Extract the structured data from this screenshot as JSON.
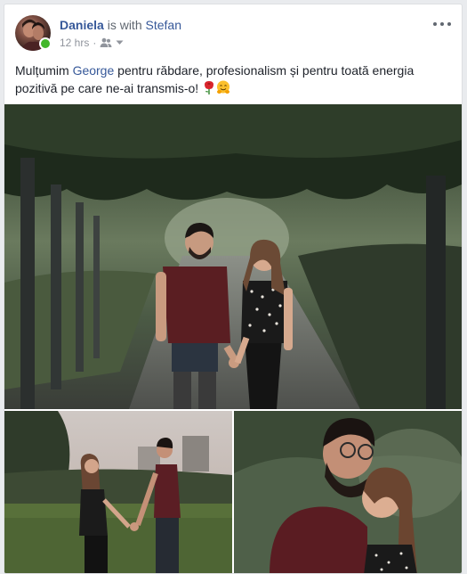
{
  "post": {
    "author": "Daniela",
    "with_text": "is with",
    "with_name": "Stefan",
    "time": "12 hrs",
    "separator": "·",
    "caption_part1": "Mulțumim ",
    "caption_mention": "George",
    "caption_part2": " pentru răbdare, profesionalism și pentru toată energia pozitivă pe care ne-ai transmis-o! ",
    "emojis": [
      "rose-emoji",
      "hugging-face-emoji"
    ],
    "online": true
  },
  "icons": {
    "audience": "friends-icon",
    "chevron": "chevron-down-icon",
    "more": "more-options-icon"
  },
  "colors": {
    "link": "#365899",
    "online": "#42b72a",
    "meta": "#90949c"
  },
  "photos": [
    {
      "name": "photo-couple-walking-under-pergola"
    },
    {
      "name": "photo-couple-holding-hands-in-park"
    },
    {
      "name": "photo-couple-hugging"
    }
  ]
}
